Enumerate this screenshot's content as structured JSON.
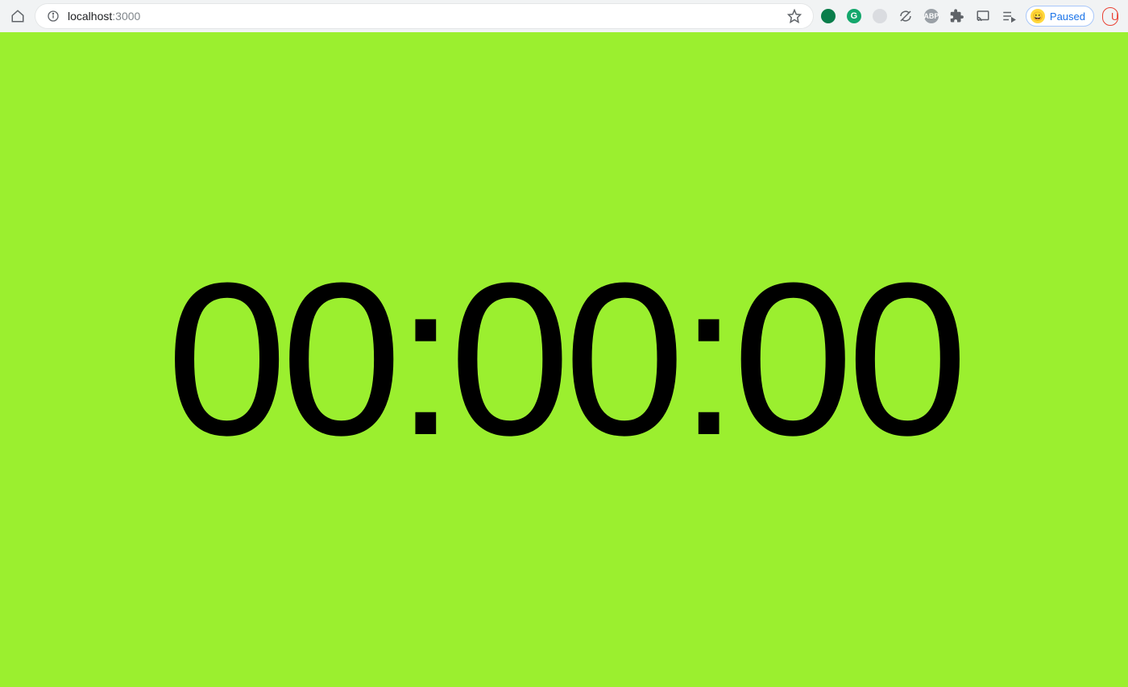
{
  "browser": {
    "url_host": "localhost",
    "url_port": ":3000",
    "paused_label": "Paused",
    "update_label": "Up",
    "extensions": {
      "grammarly_letter": "G",
      "abp_label": "ABP"
    }
  },
  "page": {
    "background_color": "#9bef2f",
    "timer_display": "00:00:00"
  }
}
